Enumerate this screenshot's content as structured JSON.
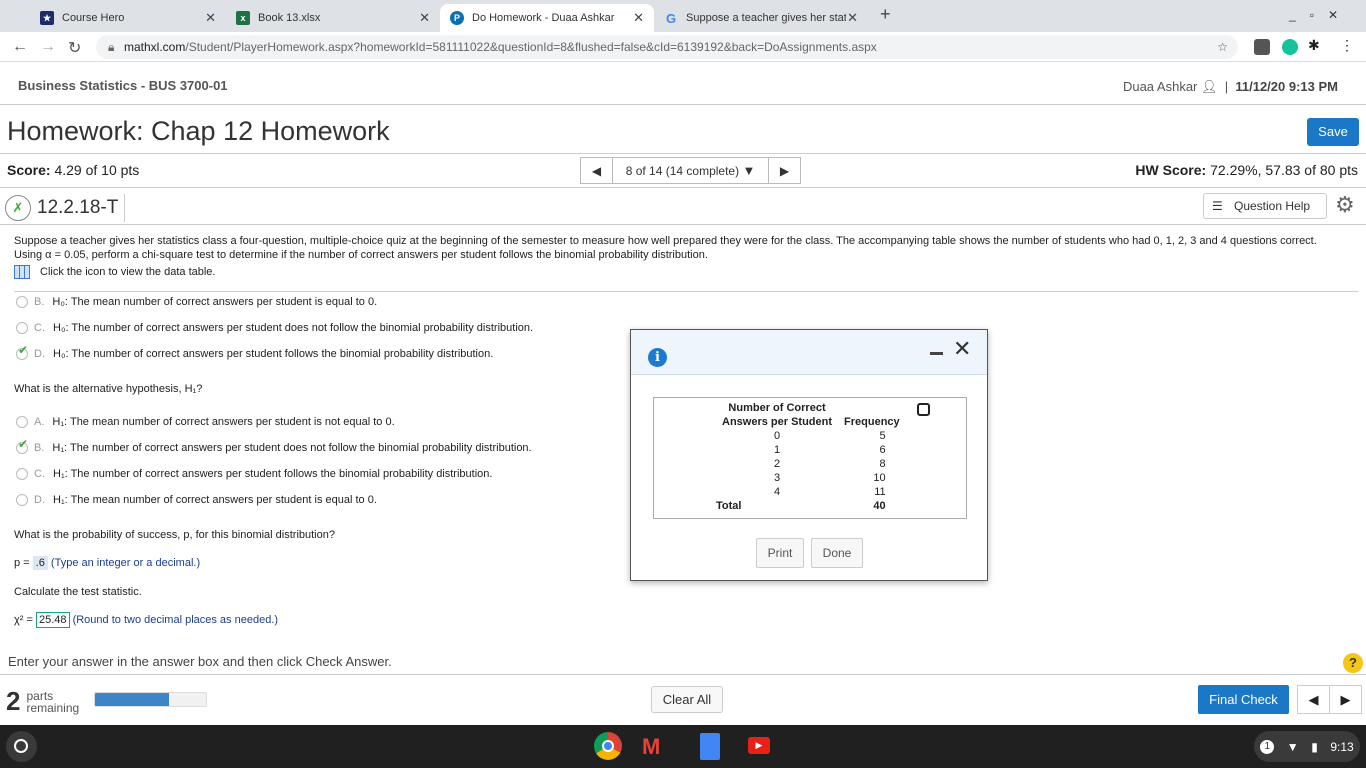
{
  "browser": {
    "tabs": [
      {
        "title": "Course Hero"
      },
      {
        "title": "Book 13.xlsx"
      },
      {
        "title": "Do Homework - Duaa Ashkar"
      },
      {
        "title": "Suppose a teacher gives her stat"
      }
    ],
    "url_host": "mathxl.com",
    "url_path": "/Student/PlayerHomework.aspx?homeworkId=581111022&questionId=8&flushed=false&cId=6139192&back=DoAssignments.aspx"
  },
  "header": {
    "course": "Business Statistics - BUS 3700-01",
    "user": "Duaa Ashkar",
    "datetime": "11/12/20 9:13 PM"
  },
  "homework": {
    "title": "Homework: Chap 12 Homework",
    "save": "Save",
    "score_label": "Score:",
    "score": "4.29 of 10 pts",
    "question_nav": "8 of 14 (14 complete)",
    "hw_score_label": "HW Score:",
    "hw_score": "72.29%, 57.83 of 80 pts",
    "question_id": "12.2.18-T",
    "question_help": "Question Help"
  },
  "question": {
    "text": "Suppose a teacher gives her statistics class a four-question, multiple-choice quiz at the beginning of the semester to measure how well prepared they were for the class. The accompanying table shows the number of students who had 0, 1, 2, 3 and 4 questions correct. Using α = 0.05, perform a chi-square test to determine if the number of correct answers per student follows the binomial probability distribution.",
    "data_link": "Click the icon to view the data table.",
    "h0_options": [
      {
        "letter": "B.",
        "text": "H₀: The mean number of correct answers per student is equal to 0.",
        "checked": false
      },
      {
        "letter": "C.",
        "text": "H₀: The number of correct answers per student does not follow the binomial probability distribution.",
        "checked": false
      },
      {
        "letter": "D.",
        "text": "H₀: The number of correct answers per student follows the binomial probability distribution.",
        "checked": true
      }
    ],
    "alt_prompt": "What is the alternative hypothesis, H₁?",
    "h1_options": [
      {
        "letter": "A.",
        "text": "H₁: The mean number of correct answers per student is not equal to 0.",
        "checked": false
      },
      {
        "letter": "B.",
        "text": "H₁: The number of correct answers per student does not follow the binomial probability distribution.",
        "checked": true
      },
      {
        "letter": "C.",
        "text": "H₁: The number of correct answers per student follows the binomial probability distribution.",
        "checked": false
      },
      {
        "letter": "D.",
        "text": "H₁: The mean number of correct answers per student is equal to 0.",
        "checked": false
      }
    ],
    "p_prompt": "What is the probability of success, p, for this binomial distribution?",
    "p_label": "p =",
    "p_value": ".6",
    "p_hint": "(Type an integer or a decimal.)",
    "stat_prompt": "Calculate the test statistic.",
    "chi_label": "χ² =",
    "chi_value": "25.48",
    "chi_hint": "(Round to two decimal places as needed.)"
  },
  "footer": {
    "message": "Enter your answer in the answer box and then click Check Answer.",
    "parts_count": "2",
    "parts_label1": "parts",
    "parts_label2": "remaining",
    "progress": 0.67,
    "clear_all": "Clear All",
    "final_check": "Final Check"
  },
  "modal": {
    "header1": "Number of Correct",
    "header2": "Answers per Student",
    "header3": "Frequency",
    "rows": [
      {
        "x": "0",
        "f": "5"
      },
      {
        "x": "1",
        "f": "6"
      },
      {
        "x": "2",
        "f": "8"
      },
      {
        "x": "3",
        "f": "10"
      },
      {
        "x": "4",
        "f": "11"
      }
    ],
    "total_label": "Total",
    "total": "40",
    "print": "Print",
    "done": "Done"
  },
  "shelf": {
    "time": "9:13",
    "notif": "1"
  }
}
